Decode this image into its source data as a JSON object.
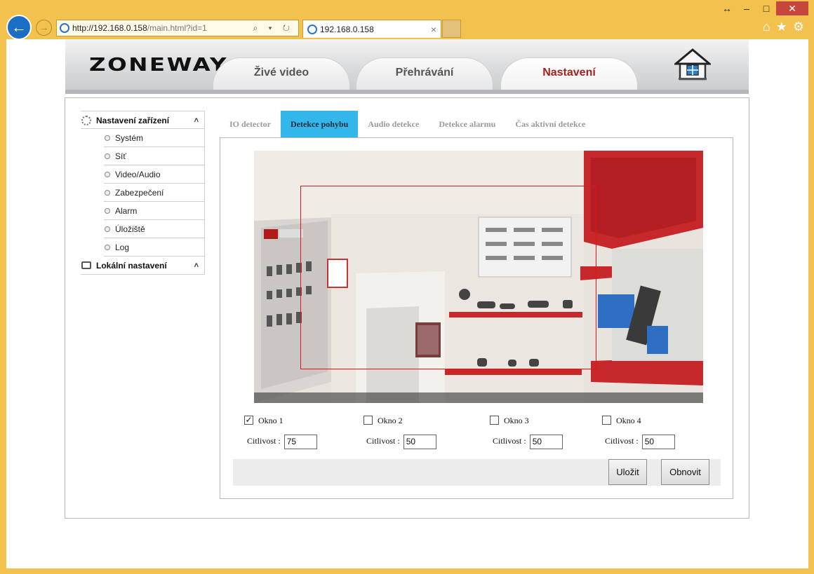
{
  "browser": {
    "address_host": "http://192.168.0.158",
    "address_path": "/main.html?id=1",
    "tab_title": "192.168.0.158",
    "addr_tools": "⌕ ▾ ↻",
    "tab_close": "×",
    "win_restore": "↔",
    "win_minimize": "–",
    "win_maximize": "□",
    "win_close": "✕",
    "back": "←",
    "forward": "→",
    "home": "⌂",
    "favorites": "★",
    "tools": "⚙"
  },
  "header": {
    "logo_part1": "ZO",
    "logo_part2": "NEWAY",
    "tabs": [
      {
        "label": "Živé video"
      },
      {
        "label": "Přehrávání"
      },
      {
        "label": "Nastavení"
      }
    ]
  },
  "sidebar": {
    "section1": "Nastavení zařízení",
    "section2": "Lokální nastavení",
    "caret": "˄",
    "items": [
      {
        "label": "Systém"
      },
      {
        "label": "Síť"
      },
      {
        "label": "Video/Audio"
      },
      {
        "label": "Zabezpečení"
      },
      {
        "label": "Alarm"
      },
      {
        "label": "Úložiště"
      },
      {
        "label": "Log"
      }
    ]
  },
  "subtabs": [
    {
      "label": "IO detector"
    },
    {
      "label": "Detekce pohybu"
    },
    {
      "label": "Audio detekce"
    },
    {
      "label": "Detekce alarmu"
    },
    {
      "label": "Čas aktivní detekce"
    }
  ],
  "windows": [
    {
      "label": "Okno 1",
      "checked": "✓",
      "sens_label": "Citlivost :",
      "sens_value": "75"
    },
    {
      "label": "Okno 2",
      "checked": "",
      "sens_label": "Citlivost :",
      "sens_value": "50"
    },
    {
      "label": "Okno 3",
      "checked": "",
      "sens_label": "Citlivost :",
      "sens_value": "50"
    },
    {
      "label": "Okno 4",
      "checked": "",
      "sens_label": "Citlivost :",
      "sens_value": "50"
    }
  ],
  "buttons": {
    "save": "Uložit",
    "refresh": "Obnovit"
  }
}
